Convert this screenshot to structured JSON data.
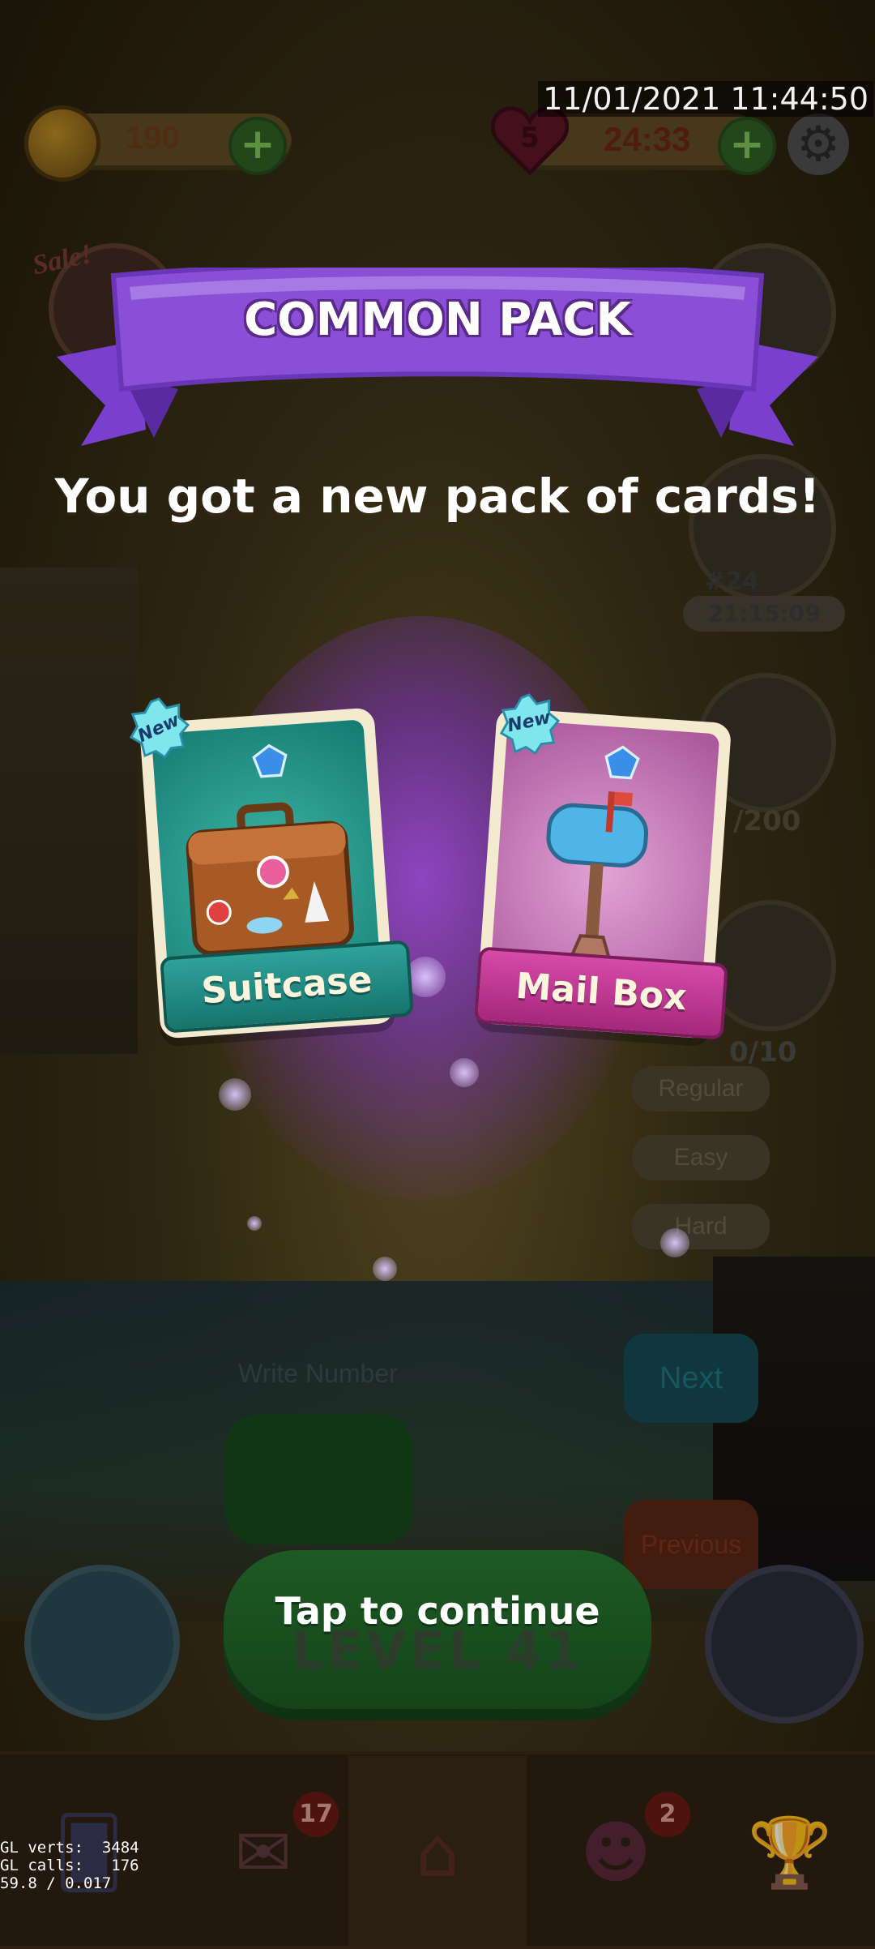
{
  "status": {
    "timestamp": "11/01/2021 11:44:50"
  },
  "hud": {
    "coins": "190",
    "lives": "5",
    "life_timer": "24:33",
    "icons": {
      "coin": "coin-icon",
      "plus": "plus-icon",
      "heart": "heart-icon",
      "settings": "gear-icon"
    }
  },
  "background": {
    "sale_label": "Sale!",
    "race_number": "#24",
    "race_timer": "21:15:09",
    "stars_count": "/200",
    "gem_count": "0/10",
    "mode_buttons": [
      "Regular",
      "Easy",
      "Hard"
    ],
    "write_number_placeholder": "Write Number",
    "next_label": "Next",
    "previous_label": "Previous",
    "level_label": "LEVEL 41"
  },
  "popup": {
    "banner_title": "COMMON PACK",
    "subtitle": "You got a new pack of cards!",
    "cards": [
      {
        "name": "Suitcase",
        "badge": "New",
        "color": "#1f8f86"
      },
      {
        "name": "Mail Box",
        "badge": "New",
        "color": "#c13a96"
      }
    ],
    "continue_label": "Tap to continue"
  },
  "bottom_nav": {
    "items": [
      {
        "icon": "cards-icon"
      },
      {
        "icon": "mail-heart-icon",
        "badge": "17"
      },
      {
        "icon": "home-icon"
      },
      {
        "icon": "team-icon",
        "badge": "2"
      },
      {
        "icon": "trophy-icon"
      }
    ]
  },
  "debug": {
    "line1": "GL verts:  3484",
    "line2": "GL calls:   176",
    "line3": "59.8 / 0.017"
  },
  "colors": {
    "banner_purple": "#8a4fd6",
    "glow_purple": "#9646d2",
    "play_green": "#1d5a24"
  }
}
